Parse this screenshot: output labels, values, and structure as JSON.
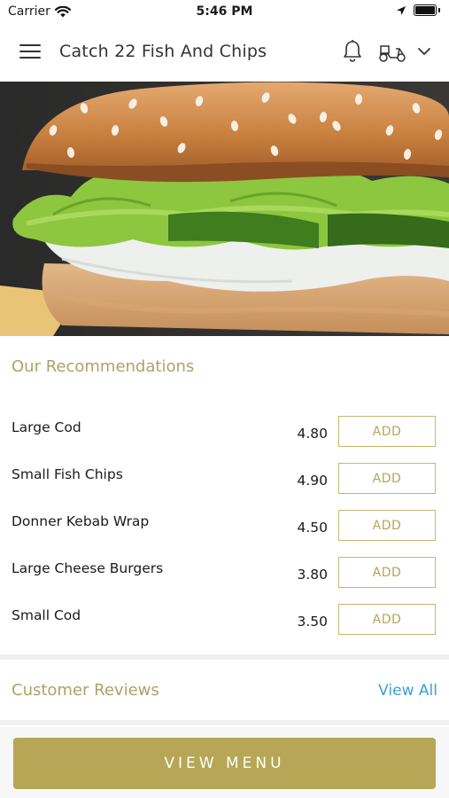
{
  "status_bar": {
    "carrier": "Carrier",
    "time": "5:46 PM"
  },
  "header": {
    "title": "Catch 22 Fish And Chips"
  },
  "recommendations": {
    "title": "Our Recommendations",
    "items": [
      {
        "name": "Large Cod",
        "price": "4.80",
        "button": "ADD"
      },
      {
        "name": "Small Fish Chips",
        "price": "4.90",
        "button": "ADD"
      },
      {
        "name": "Donner Kebab Wrap",
        "price": "4.50",
        "button": "ADD"
      },
      {
        "name": "Large Cheese Burgers",
        "price": "3.80",
        "button": "ADD"
      },
      {
        "name": "Small Cod",
        "price": "3.50",
        "button": "ADD"
      }
    ]
  },
  "reviews": {
    "title": "Customer Reviews",
    "view_all": "View All"
  },
  "footer": {
    "button": "VIEW MENU"
  },
  "colors": {
    "accent": "#b7a655",
    "link": "#3b9fd6",
    "section_title": "#b0a06a"
  }
}
